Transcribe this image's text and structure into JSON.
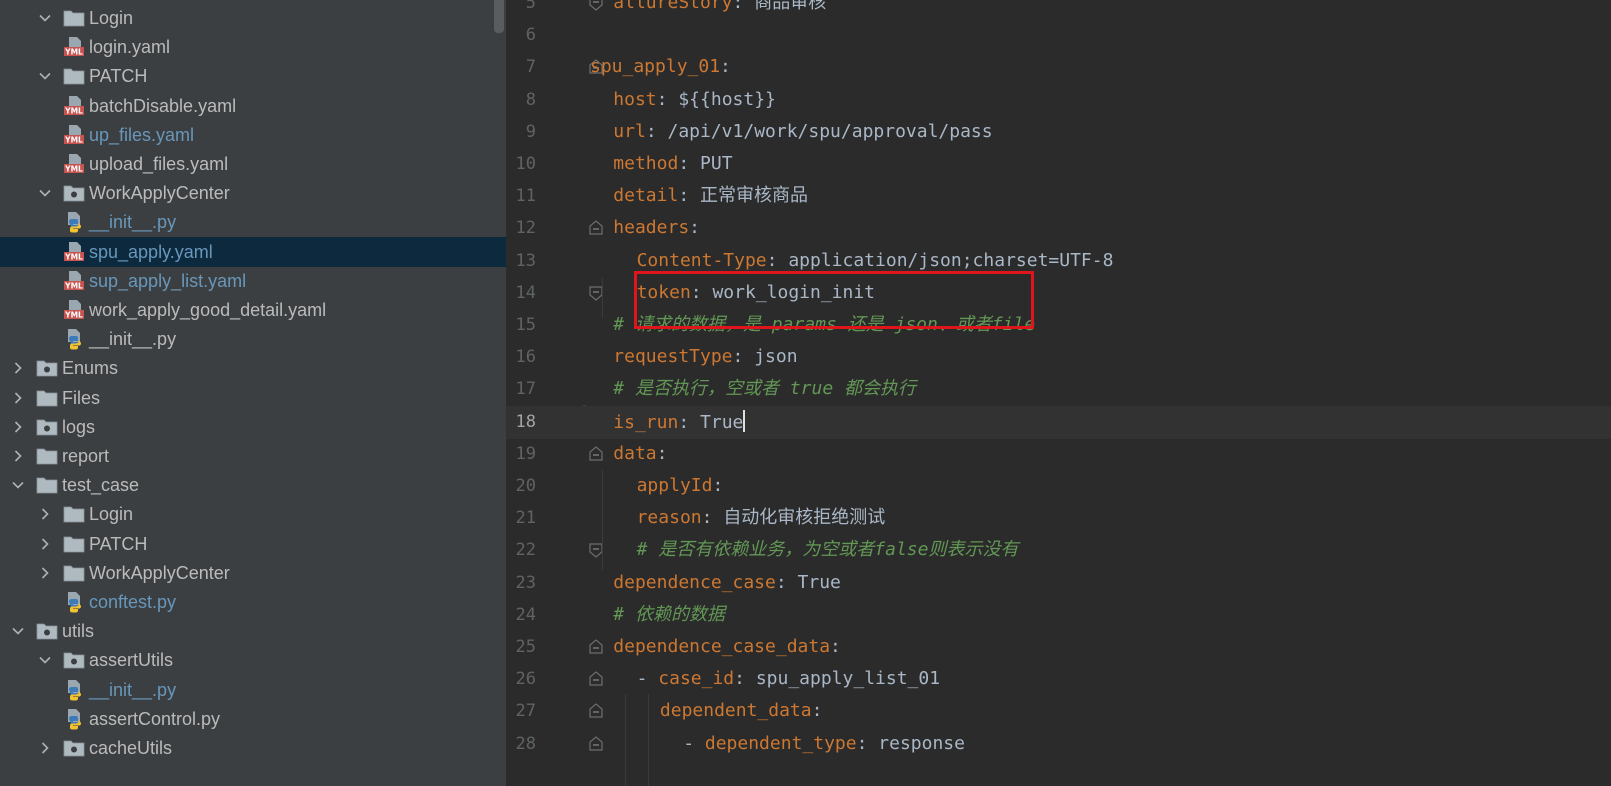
{
  "project_tree": [
    {
      "label": "Login",
      "depth": 1,
      "kind": "folder",
      "expanded": true
    },
    {
      "label": "login.yaml",
      "depth": 2,
      "kind": "yaml"
    },
    {
      "label": "PATCH",
      "depth": 1,
      "kind": "folder",
      "expanded": true
    },
    {
      "label": "batchDisable.yaml",
      "depth": 2,
      "kind": "yaml"
    },
    {
      "label": "up_files.yaml",
      "depth": 2,
      "kind": "yaml",
      "vcs": true
    },
    {
      "label": "upload_files.yaml",
      "depth": 2,
      "kind": "yaml"
    },
    {
      "label": "WorkApplyCenter",
      "depth": 1,
      "kind": "package",
      "expanded": true
    },
    {
      "label": "__init__.py",
      "depth": 2,
      "kind": "python",
      "vcs": true
    },
    {
      "label": "spu_apply.yaml",
      "depth": 2,
      "kind": "yaml",
      "vcs": true,
      "selected": true
    },
    {
      "label": "sup_apply_list.yaml",
      "depth": 2,
      "kind": "yaml",
      "vcs": true
    },
    {
      "label": "work_apply_good_detail.yaml",
      "depth": 2,
      "kind": "yaml"
    },
    {
      "label": "__init__.py",
      "depth": 1,
      "kind": "python",
      "leaf": true
    },
    {
      "label": "Enums",
      "depth": 0,
      "kind": "package",
      "expanded": false
    },
    {
      "label": "Files",
      "depth": 0,
      "kind": "folder",
      "expanded": false
    },
    {
      "label": "logs",
      "depth": 0,
      "kind": "package",
      "expanded": false
    },
    {
      "label": "report",
      "depth": 0,
      "kind": "folder",
      "expanded": false
    },
    {
      "label": "test_case",
      "depth": 0,
      "kind": "folder",
      "expanded": true
    },
    {
      "label": "Login",
      "depth": 1,
      "kind": "folder",
      "expanded": false
    },
    {
      "label": "PATCH",
      "depth": 1,
      "kind": "folder",
      "expanded": false
    },
    {
      "label": "WorkApplyCenter",
      "depth": 1,
      "kind": "folder",
      "expanded": false
    },
    {
      "label": "conftest.py",
      "depth": 1,
      "kind": "python",
      "vcs": true,
      "leaf": true
    },
    {
      "label": "utils",
      "depth": 0,
      "kind": "package",
      "expanded": true
    },
    {
      "label": "assertUtils",
      "depth": 1,
      "kind": "package",
      "expanded": true
    },
    {
      "label": "__init__.py",
      "depth": 2,
      "kind": "python",
      "vcs": true
    },
    {
      "label": "assertControl.py",
      "depth": 2,
      "kind": "python"
    },
    {
      "label": "cacheUtils",
      "depth": 1,
      "kind": "package",
      "expanded": false
    }
  ],
  "editor": {
    "current_line": 18,
    "lines": [
      {
        "n": "5",
        "indent": 1,
        "fold": "end",
        "parts": [
          [
            "k",
            "allureStory"
          ],
          [
            "p",
            ": "
          ],
          [
            "v",
            "商品审核"
          ]
        ]
      },
      {
        "n": "6",
        "indent": 0,
        "parts": []
      },
      {
        "n": "7",
        "indent": 0,
        "fold": "start",
        "parts": [
          [
            "k",
            "spu_apply_01"
          ],
          [
            "p",
            ":"
          ]
        ]
      },
      {
        "n": "8",
        "indent": 1,
        "parts": [
          [
            "k",
            "host"
          ],
          [
            "p",
            ": "
          ],
          [
            "v",
            "${{host}}"
          ]
        ]
      },
      {
        "n": "9",
        "indent": 1,
        "parts": [
          [
            "k",
            "url"
          ],
          [
            "p",
            ": "
          ],
          [
            "v",
            "/api/v1/work/spu/approval/pass"
          ]
        ]
      },
      {
        "n": "10",
        "indent": 1,
        "parts": [
          [
            "k",
            "method"
          ],
          [
            "p",
            ": "
          ],
          [
            "v",
            "PUT"
          ]
        ]
      },
      {
        "n": "11",
        "indent": 1,
        "parts": [
          [
            "k",
            "detail"
          ],
          [
            "p",
            ": "
          ],
          [
            "v",
            "正常审核商品"
          ]
        ]
      },
      {
        "n": "12",
        "indent": 1,
        "fold": "start",
        "parts": [
          [
            "k",
            "headers"
          ],
          [
            "p",
            ":"
          ]
        ]
      },
      {
        "n": "13",
        "indent": 2,
        "parts": [
          [
            "k",
            "Content-Type"
          ],
          [
            "p",
            ": "
          ],
          [
            "v",
            "application/json;charset=UTF-8"
          ]
        ]
      },
      {
        "n": "14",
        "indent": 2,
        "fold": "end",
        "parts": [
          [
            "k",
            "token"
          ],
          [
            "p",
            ": "
          ],
          [
            "v",
            "work_login_init"
          ]
        ]
      },
      {
        "n": "15",
        "indent": 1,
        "parts": [
          [
            "c",
            "# 请求的数据，是 params 还是 json、或者file"
          ]
        ]
      },
      {
        "n": "16",
        "indent": 1,
        "parts": [
          [
            "k",
            "requestType"
          ],
          [
            "p",
            ": "
          ],
          [
            "v",
            "json"
          ]
        ]
      },
      {
        "n": "17",
        "indent": 1,
        "parts": [
          [
            "c",
            "# 是否执行，空或者 true 都会执行"
          ]
        ]
      },
      {
        "n": "18",
        "indent": 1,
        "caret": true,
        "parts": [
          [
            "k",
            "is_run"
          ],
          [
            "p",
            ": "
          ],
          [
            "v",
            "True"
          ]
        ]
      },
      {
        "n": "19",
        "indent": 1,
        "fold": "start",
        "parts": [
          [
            "k",
            "data"
          ],
          [
            "p",
            ":"
          ]
        ]
      },
      {
        "n": "20",
        "indent": 2,
        "parts": [
          [
            "k",
            "applyId"
          ],
          [
            "p",
            ":"
          ]
        ]
      },
      {
        "n": "21",
        "indent": 2,
        "parts": [
          [
            "k",
            "reason"
          ],
          [
            "p",
            ": "
          ],
          [
            "v",
            "自动化审核拒绝测试"
          ]
        ]
      },
      {
        "n": "22",
        "indent": 2,
        "fold": "end",
        "parts": [
          [
            "c",
            "# 是否有依赖业务，为空或者false则表示没有"
          ]
        ]
      },
      {
        "n": "23",
        "indent": 1,
        "parts": [
          [
            "k",
            "dependence_case"
          ],
          [
            "p",
            ": "
          ],
          [
            "v",
            "True"
          ]
        ]
      },
      {
        "n": "24",
        "indent": 1,
        "parts": [
          [
            "c",
            "# 依赖的数据"
          ]
        ]
      },
      {
        "n": "25",
        "indent": 1,
        "fold": "start",
        "parts": [
          [
            "k",
            "dependence_case_data"
          ],
          [
            "p",
            ":"
          ]
        ]
      },
      {
        "n": "26",
        "indent": 2,
        "fold": "start",
        "parts": [
          [
            "p",
            "- "
          ],
          [
            "k",
            "case_id"
          ],
          [
            "p",
            ": "
          ],
          [
            "v",
            "spu_apply_list_01"
          ]
        ]
      },
      {
        "n": "27",
        "indent": 3,
        "fold": "start",
        "parts": [
          [
            "k",
            "dependent_data"
          ],
          [
            "p",
            ":"
          ]
        ]
      },
      {
        "n": "28",
        "indent": 4,
        "fold": "start",
        "parts": [
          [
            "p",
            "- "
          ],
          [
            "k",
            "dependent_type"
          ],
          [
            "p",
            ": "
          ],
          [
            "v",
            "response"
          ]
        ]
      }
    ]
  },
  "colors": {
    "tree_bg": "#3c3f41",
    "editor_bg": "#2b2b2b",
    "key": "#cc7832",
    "comment": "#629755",
    "selection": "#0d293e",
    "annotation_box": "#e0141b"
  }
}
